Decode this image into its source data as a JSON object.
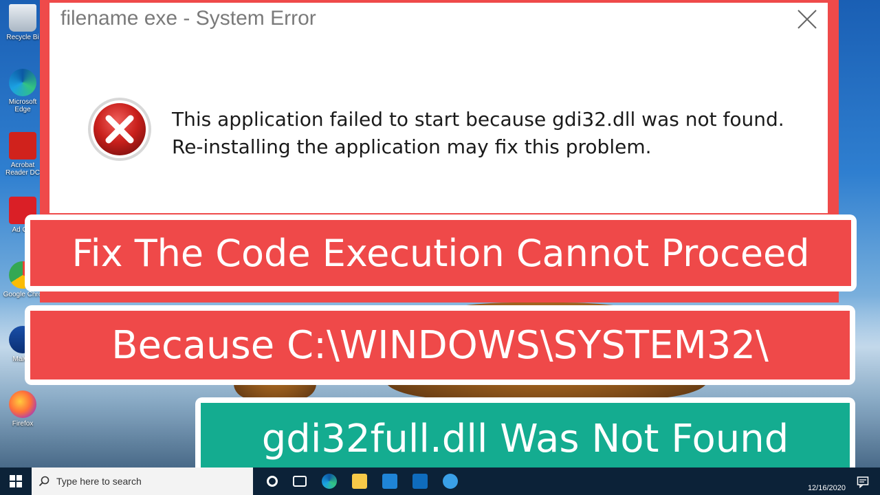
{
  "dialog": {
    "title": "filename exe - System Error",
    "message": "This application failed to start because gdi32.dll was not found. Re-installing the application may fix this problem."
  },
  "banners": {
    "line1": "Fix The Code Execution Cannot Proceed",
    "line2": "Because C:\\WINDOWS\\SYSTEM32\\",
    "line3": "gdi32full.dll Was Not Found"
  },
  "desktop_icons": [
    {
      "label": "Recycle Bi",
      "icon": "recycle-bin-icon"
    },
    {
      "label": "Microsoft Edge",
      "icon": "edge-icon"
    },
    {
      "label": "Acrobat Reader DC",
      "icon": "acrobat-icon"
    },
    {
      "label": "Ad Cre",
      "icon": "creative-cloud-icon"
    },
    {
      "label": "Google Chro",
      "icon": "chrome-icon"
    },
    {
      "label": "Malwa",
      "icon": "malwarebytes-icon"
    },
    {
      "label": "Firefox",
      "icon": "firefox-icon"
    }
  ],
  "taskbar": {
    "search_placeholder": "Type here to search",
    "date": "12/16/2020"
  },
  "colors": {
    "banner_red": "#ef4949",
    "banner_green": "#14ac90",
    "dialog_border": "#ef4a4a",
    "error_red": "#c9201c"
  }
}
